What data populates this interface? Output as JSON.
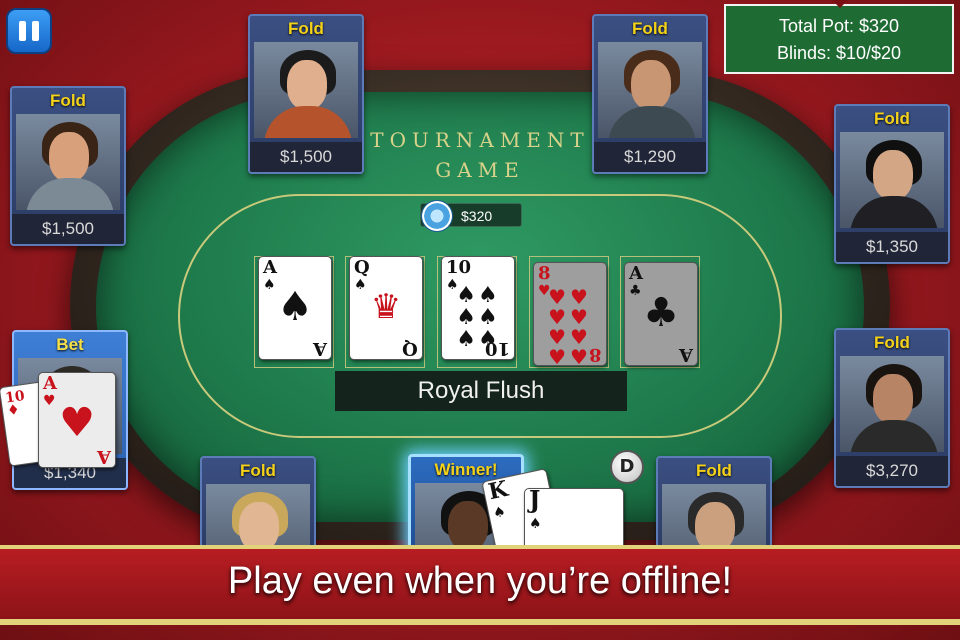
{
  "header": {
    "pause_icon": "pause-icon",
    "total_pot": "Total Pot: $320",
    "blinds": "Blinds: $10/$20"
  },
  "table": {
    "title_line1": "TOURNAMENT",
    "title_line2": "GAME",
    "pot": "$320",
    "hand_name": "Royal Flush",
    "dealer_button": "D"
  },
  "seats": [
    {
      "status": "Fold",
      "chips": "$1,500"
    },
    {
      "status": "Fold",
      "chips": "$1,500"
    },
    {
      "status": "Fold",
      "chips": "$1,290"
    },
    {
      "status": "Fold",
      "chips": "$1,350"
    },
    {
      "status": "Bet",
      "chips": "$1,340"
    },
    {
      "status": "Fold",
      "chips": "$3,270"
    },
    {
      "status": "Fold",
      "chips": ""
    },
    {
      "status": "Winner!",
      "chips": ""
    },
    {
      "status": "Fold",
      "chips": ""
    }
  ],
  "community_cards": [
    {
      "rank": "A",
      "suit": "♠",
      "color": "#111111"
    },
    {
      "rank": "Q",
      "suit": "♠",
      "color": "#111111"
    },
    {
      "rank": "10",
      "suit": "♠",
      "color": "#111111"
    },
    {
      "rank": "8",
      "suit": "♥",
      "color": "#c8121c"
    },
    {
      "rank": "A",
      "suit": "♣",
      "color": "#111111"
    }
  ],
  "bet_seat_cards": [
    {
      "rank": "10",
      "suit": "♦"
    },
    {
      "rank": "A",
      "suit": "♥"
    }
  ],
  "winner_cards": [
    {
      "rank": "K",
      "suit": "♠"
    },
    {
      "rank": "J",
      "suit": "♠"
    }
  ],
  "banner": {
    "text": "Play even when you’re offline!"
  }
}
